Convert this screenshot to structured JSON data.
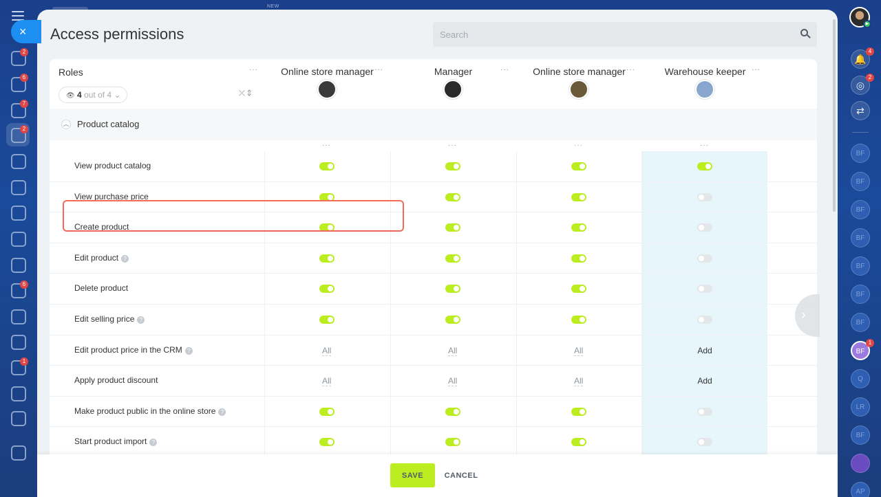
{
  "app": {
    "top_strip_label": "NEW",
    "close_label": "×"
  },
  "left_sidebar": {
    "badges": [
      "2",
      "2",
      "6",
      "7",
      "2",
      "6",
      "1"
    ]
  },
  "right_sidebar": {
    "notifications_badge": "4",
    "rocket_badge": "2",
    "avatars": [
      "BF",
      "BF",
      "BF",
      "BF",
      "BF",
      "BF",
      "BF",
      "BF",
      "Q",
      "LR",
      "BF",
      "",
      "AP"
    ],
    "highlighted_avatar_badge": "1"
  },
  "page": {
    "title": "Access permissions",
    "search_placeholder": "Search"
  },
  "roles_header": {
    "label": "Roles",
    "visible_count": "4",
    "out_of": "out of 4",
    "menu": "···"
  },
  "columns": [
    {
      "label": "Online store manager",
      "menu": "···",
      "avatar_color": "#3a3a3a"
    },
    {
      "label": "Manager",
      "menu": "···",
      "avatar_color": "#2a2a2a"
    },
    {
      "label": "Online store manager",
      "menu": "···",
      "avatar_color": "#6b5a3a"
    },
    {
      "label": "Warehouse keeper",
      "menu": "···",
      "avatar_color": "#8aa6cf"
    }
  ],
  "section": {
    "title": "Product catalog",
    "column_menu": "···"
  },
  "rows": [
    {
      "label": "View product catalog",
      "help": false,
      "values": [
        "on",
        "on",
        "on",
        "on"
      ]
    },
    {
      "label": "View purchase price",
      "help": false,
      "values": [
        "on",
        "on",
        "on",
        "off"
      ]
    },
    {
      "label": "Create product",
      "help": false,
      "values": [
        "on",
        "on",
        "on",
        "off"
      ]
    },
    {
      "label": "Edit product",
      "help": true,
      "values": [
        "on",
        "on",
        "on",
        "off"
      ]
    },
    {
      "label": "Delete product",
      "help": false,
      "values": [
        "on",
        "on",
        "on",
        "off"
      ]
    },
    {
      "label": "Edit selling price",
      "help": true,
      "values": [
        "on",
        "on",
        "on",
        "off"
      ]
    },
    {
      "label": "Edit product price in the CRM",
      "help": true,
      "values": [
        "All",
        "All",
        "All",
        "Add"
      ]
    },
    {
      "label": "Apply product discount",
      "help": false,
      "values": [
        "All",
        "All",
        "All",
        "Add"
      ]
    },
    {
      "label": "Make product public in the online store",
      "help": true,
      "values": [
        "on",
        "on",
        "on",
        "off"
      ]
    },
    {
      "label": "Start product import",
      "help": true,
      "values": [
        "on",
        "on",
        "on",
        "off"
      ]
    }
  ],
  "help_glyph": "?",
  "footer": {
    "save_label": "SAVE",
    "cancel_label": "CANCEL"
  },
  "colors": {
    "accent_toggle": "#bbed21",
    "highlight_outline": "#f26b5a",
    "warehouse_column_bg": "#e7f6fb"
  }
}
